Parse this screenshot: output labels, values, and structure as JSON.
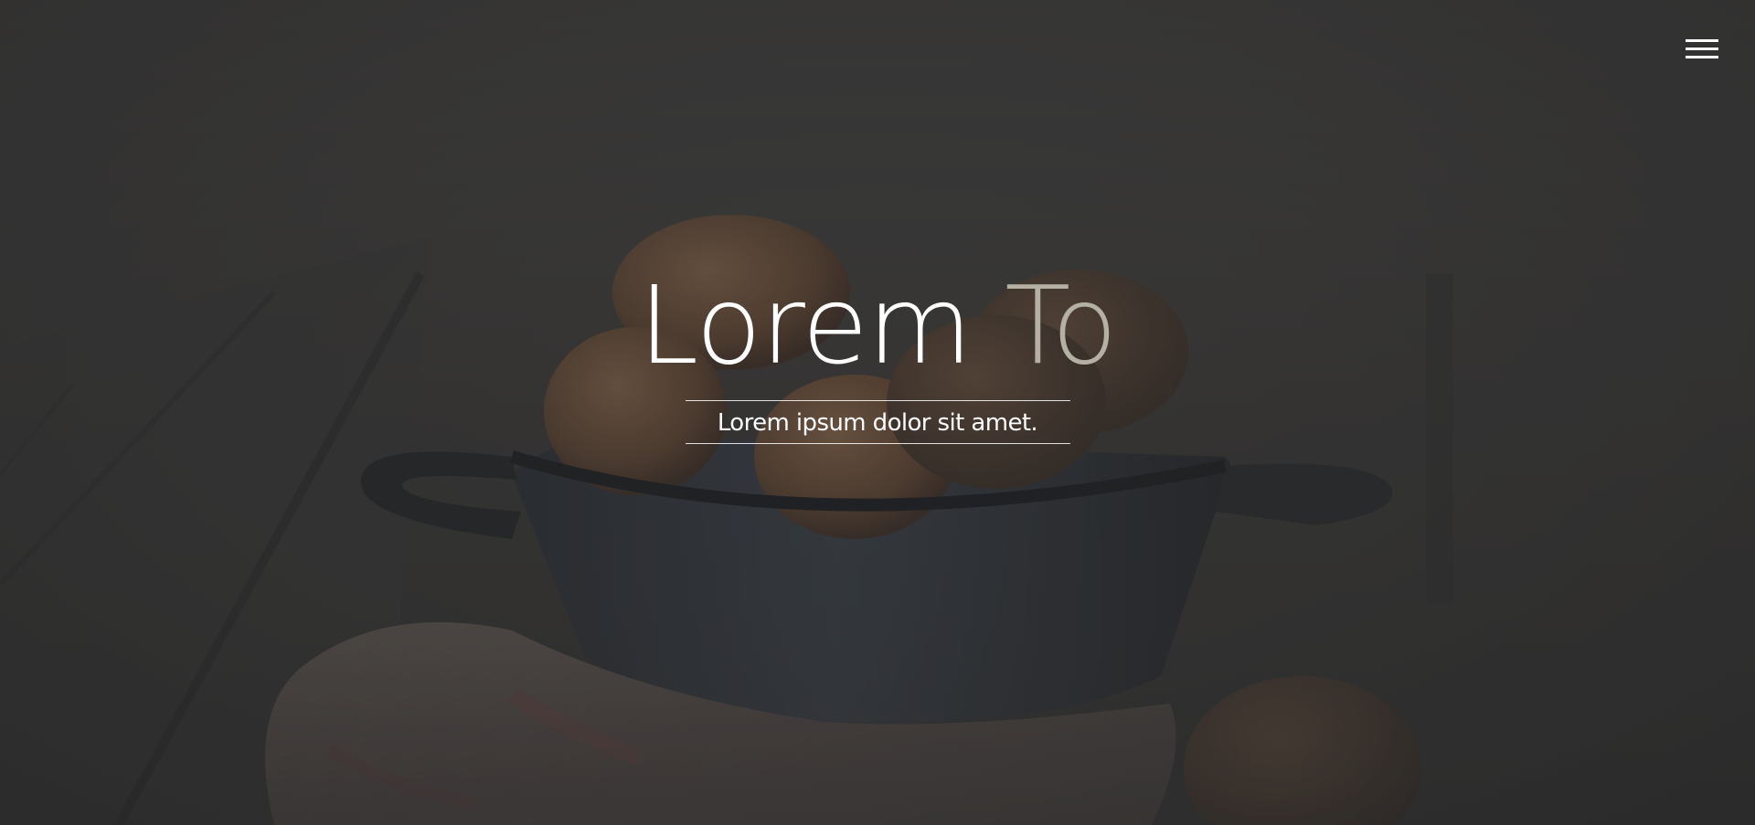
{
  "hero": {
    "title_main": "Lorem",
    "title_accent": "To",
    "subtitle": "Lorem ipsum dolor sit amet."
  },
  "menu": {
    "icon": "hamburger-menu-icon"
  },
  "colors": {
    "title": "#ffffff",
    "accent": "#b4b0a4",
    "background": "#3a3938"
  }
}
